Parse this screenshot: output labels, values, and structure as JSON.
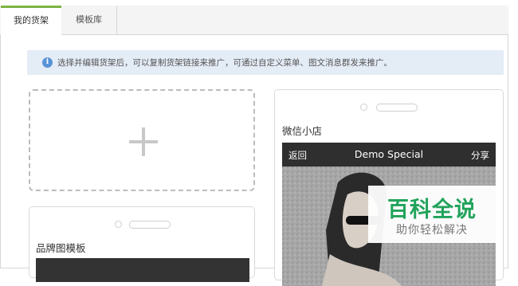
{
  "tabs": {
    "my_shelves": "我的货架",
    "template_library": "模板库"
  },
  "notice": {
    "icon": "info-icon",
    "text": "选择并编辑货架后，可以复制货架链接来推广，可通过自定义菜单、图文消息群发来推广。"
  },
  "add_card": {
    "icon": "plus-icon"
  },
  "cards": {
    "brand_template": {
      "title": "品牌图模板"
    },
    "wechat_store": {
      "title": "微信小店",
      "nav": {
        "back": "返回",
        "title": "Demo Special",
        "share": "分享"
      }
    }
  },
  "watermark": {
    "brand": "百科全说",
    "slogan": "助你轻松解决"
  },
  "colors": {
    "active_tab_accent": "#7cb342",
    "notice_bg": "#e4ecf6",
    "info_icon": "#5a93d6",
    "phone_nav_bg": "#2f2f2f",
    "watermark_green": "#21a35b"
  }
}
